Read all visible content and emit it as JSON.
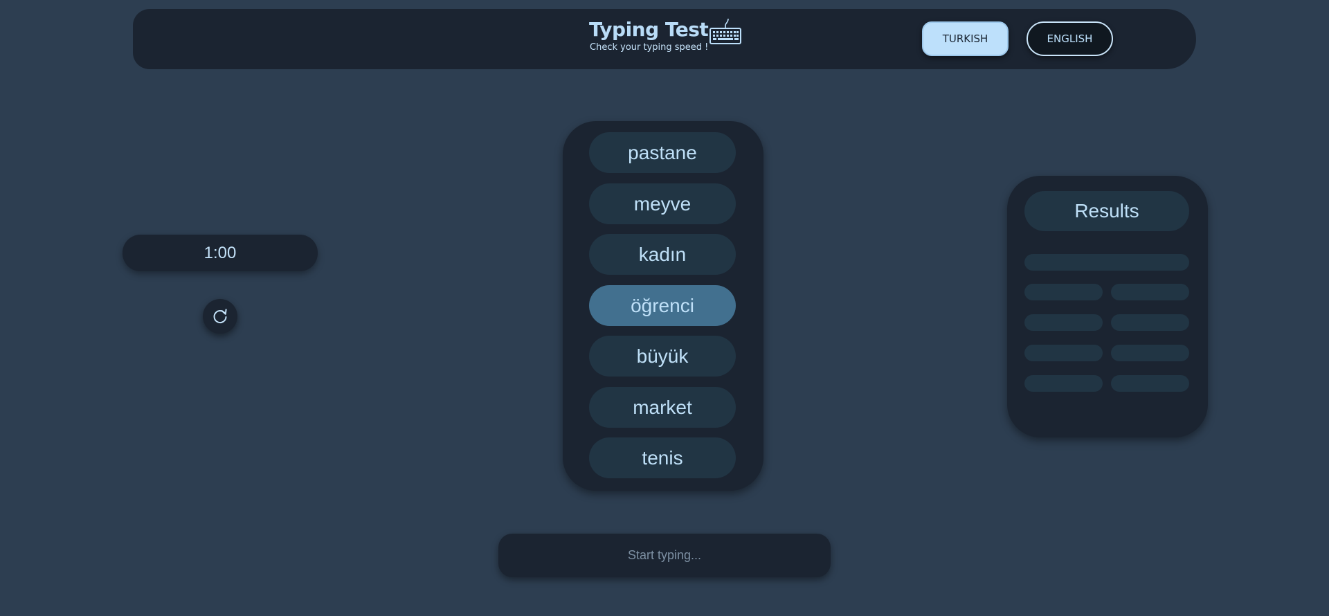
{
  "header": {
    "title": "Typing Test",
    "subtitle": "Check your typing speed !",
    "languages": {
      "turkish": "TURKISH",
      "english": "ENGLISH"
    }
  },
  "timer": {
    "value": "1:00"
  },
  "words": [
    "pastane",
    "meyve",
    "kadın",
    "öğrenci",
    "büyük",
    "market",
    "tenis"
  ],
  "active_word": "öğrenci",
  "results": {
    "title": "Results"
  },
  "input": {
    "placeholder": "Start typing...",
    "value": ""
  },
  "colors": {
    "background": "#2d3e51",
    "panel": "#1b2431",
    "pill": "#213544",
    "active_pill": "#42708f",
    "text": "#bfe0f8"
  },
  "icons": {
    "brand": "keyboard-icon",
    "restart": "refresh-icon"
  }
}
